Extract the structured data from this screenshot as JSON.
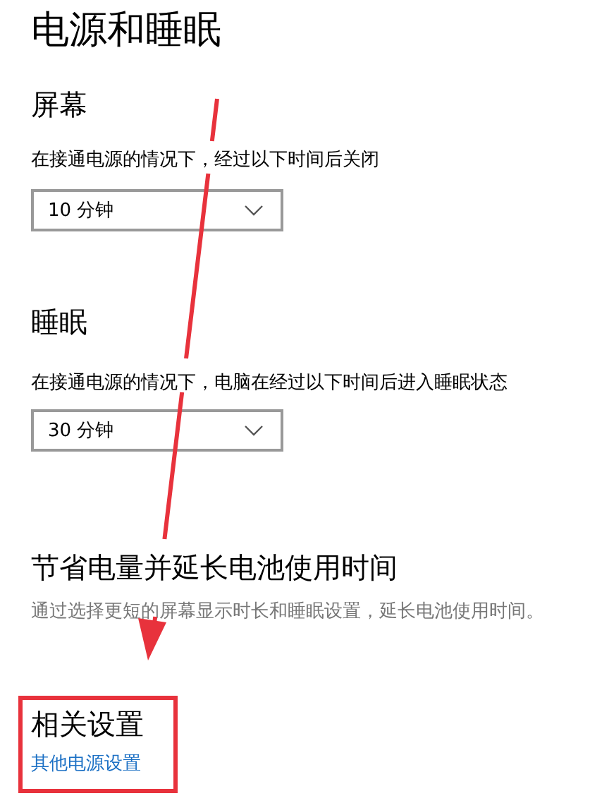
{
  "title": "电源和睡眠",
  "sections": [
    {
      "heading": "屏幕",
      "description": "在接通电源的情况下，经过以下时间后关闭",
      "dropdown": {
        "value": "10 分钟"
      }
    },
    {
      "heading": "睡眠",
      "description": "在接通电源的情况下，电脑在经过以下时间后进入睡眠状态",
      "dropdown": {
        "value": "30 分钟"
      }
    }
  ],
  "battery": {
    "heading": "节省电量并延长电池使用时间",
    "description": "通过选择更短的屏幕显示时长和睡眠设置，延长电池使用时间。"
  },
  "related": {
    "heading": "相关设置",
    "link": "其他电源设置"
  },
  "annotations": {
    "arrow": true,
    "highlight": true
  }
}
